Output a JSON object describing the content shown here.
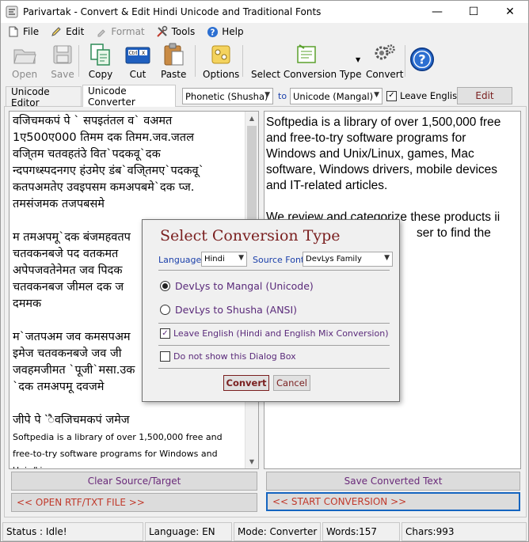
{
  "window": {
    "title": "Parivartak - Convert & Edit Hindi Unicode and Traditional Fonts",
    "minimize_glyph": "—",
    "maximize_glyph": "☐",
    "close_glyph": "✕"
  },
  "menu": {
    "file": "File",
    "edit": "Edit",
    "format": "Format",
    "tools": "Tools",
    "help": "Help"
  },
  "toolbar": {
    "open": "Open",
    "save": "Save",
    "copy": "Copy",
    "cut": "Cut",
    "paste": "Paste",
    "options": "Options",
    "select_conversion_type": "Select Conversion Type",
    "convert": "Convert"
  },
  "tabs": {
    "unicode_editor": "Unicode Editor",
    "unicode_converter": "Unicode Converter"
  },
  "converter": {
    "source_font": "Phonetic (Shusha)",
    "to_label": "to",
    "target_font": "Unicode (Mangal)",
    "leave_english_label": "Leave English",
    "leave_english_checked": "✓",
    "edit_button": "Edit"
  },
  "source_text": {
    "lines": [
      "वजिचमकपं पे ` सपइतंतल व` वअमत",
      "1ए500ए000 तिमम दक तिमम.जव.जतल",
      "वजि्तम चतवहतंउे वित`पदकवू`दक",
      "न्दपगध्स्पदनगए हंउमेए डंब`वजि्तमए`पदकवू`",
      "कतपअमतेए उवइपसम कमअपबमे`दक प्ज.",
      "तमसंजमक तजपबसमे",
      "म तमअपमू`दक बंजमहवतप",
      "चतवकनबजे पद वतकमत",
      "अपेपजवतेनेमत जव पिदक",
      "चतवकनबज जीमल दक ज",
      "दममक",
      "म`जतपअम जव कमसपअम",
      "इमेज चतवकनबजे जव जी",
      "जवहमजीमत `पूजी`मसा.उक",
      "`दक तमअपमू दवजमे",
      "जीपे पे `ैवजिचमकपं जमेज"
    ],
    "english_small": "Softpedia is a library of over 1,500,000 free and free-to-try software programs for Windows and Unix/Linux,"
  },
  "target_text": {
    "para1": "Softpedia is a library of over 1,500,000 free and free-to-try software programs for Windows and Unix/Linux, games, Mac software, Windows drivers, mobile devices and IT-related articles.",
    "para2_line1": "We review and categorize these products ii",
    "para2_line2": "ser to find the"
  },
  "buttons": {
    "clear": "Clear Source/Target",
    "save_converted": "Save Converted Text",
    "open_file": "<< OPEN RTF/TXT FILE >>",
    "start_conversion": "<< START CONVERSION >>"
  },
  "status": {
    "status": "Status : Idle!",
    "language": "Language: EN",
    "mode": "Mode: Converter",
    "words": "Words:157",
    "chars": "Chars:993"
  },
  "dialog": {
    "title": "Select Conversion Type",
    "language_label": "Language",
    "language_value": "Hindi",
    "source_font_label": "Source Font",
    "source_font_value": "DevLys Family",
    "option1": "DevLys to Mangal (Unicode)",
    "option2": "DevLys to Shusha (ANSI)",
    "leave_english": "Leave English (Hindi and English Mix Conversion)",
    "leave_english_checked": "✓",
    "do_not_show": "Do not show this Dialog Box",
    "convert": "Convert",
    "cancel": "Cancel"
  },
  "colors": {
    "accent_blue": "#1565c0",
    "dialog_title": "#7a1f1f",
    "purple_text": "#5a2a7a",
    "red_text": "#c0392b"
  }
}
